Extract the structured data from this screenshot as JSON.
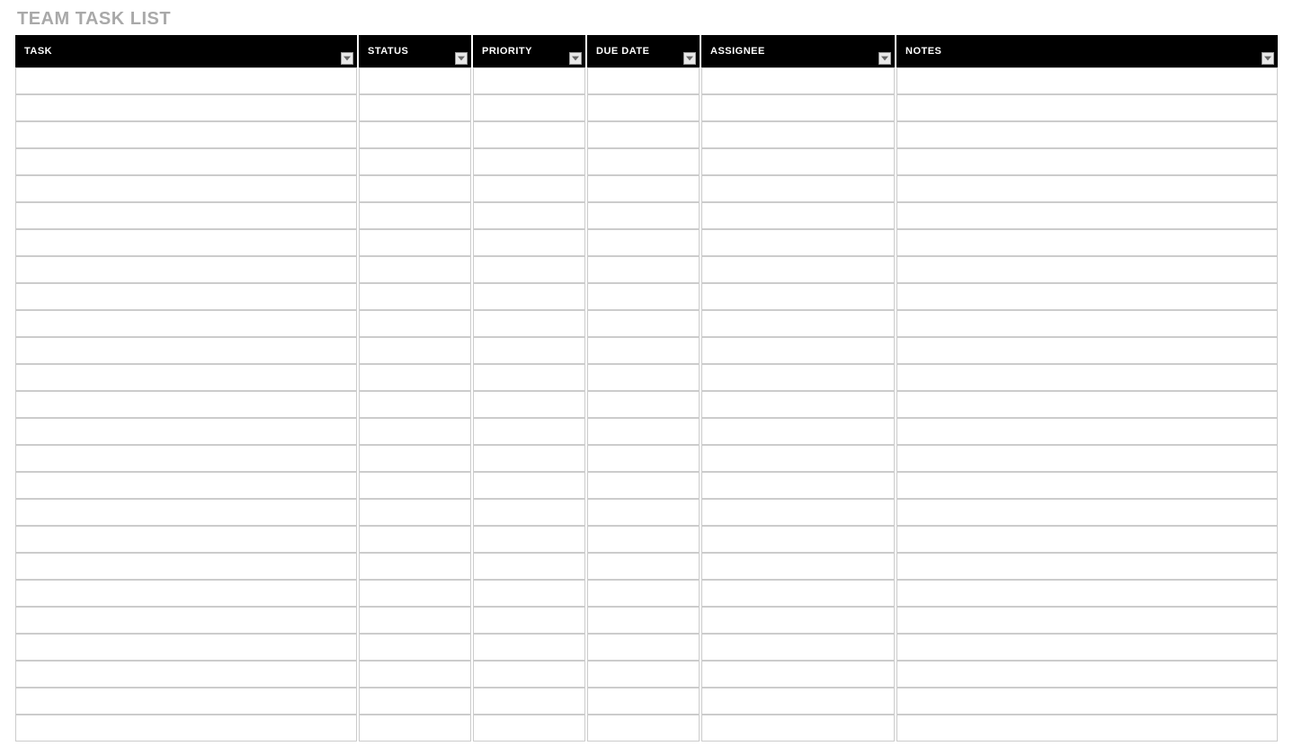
{
  "title": "TEAM TASK LIST",
  "columns": [
    {
      "label": "TASK",
      "key": "task",
      "filterable": true
    },
    {
      "label": "STATUS",
      "key": "status",
      "filterable": true
    },
    {
      "label": "PRIORITY",
      "key": "priority",
      "filterable": true
    },
    {
      "label": "DUE DATE",
      "key": "due_date",
      "filterable": true
    },
    {
      "label": "ASSIGNEE",
      "key": "assignee",
      "filterable": true
    },
    {
      "label": "NOTES",
      "key": "notes",
      "filterable": true
    }
  ],
  "rows": [
    {
      "task": "",
      "status": "",
      "priority": "",
      "due_date": "",
      "assignee": "",
      "notes": ""
    },
    {
      "task": "",
      "status": "",
      "priority": "",
      "due_date": "",
      "assignee": "",
      "notes": ""
    },
    {
      "task": "",
      "status": "",
      "priority": "",
      "due_date": "",
      "assignee": "",
      "notes": ""
    },
    {
      "task": "",
      "status": "",
      "priority": "",
      "due_date": "",
      "assignee": "",
      "notes": ""
    },
    {
      "task": "",
      "status": "",
      "priority": "",
      "due_date": "",
      "assignee": "",
      "notes": ""
    },
    {
      "task": "",
      "status": "",
      "priority": "",
      "due_date": "",
      "assignee": "",
      "notes": ""
    },
    {
      "task": "",
      "status": "",
      "priority": "",
      "due_date": "",
      "assignee": "",
      "notes": ""
    },
    {
      "task": "",
      "status": "",
      "priority": "",
      "due_date": "",
      "assignee": "",
      "notes": ""
    },
    {
      "task": "",
      "status": "",
      "priority": "",
      "due_date": "",
      "assignee": "",
      "notes": ""
    },
    {
      "task": "",
      "status": "",
      "priority": "",
      "due_date": "",
      "assignee": "",
      "notes": ""
    },
    {
      "task": "",
      "status": "",
      "priority": "",
      "due_date": "",
      "assignee": "",
      "notes": ""
    },
    {
      "task": "",
      "status": "",
      "priority": "",
      "due_date": "",
      "assignee": "",
      "notes": ""
    },
    {
      "task": "",
      "status": "",
      "priority": "",
      "due_date": "",
      "assignee": "",
      "notes": ""
    },
    {
      "task": "",
      "status": "",
      "priority": "",
      "due_date": "",
      "assignee": "",
      "notes": ""
    },
    {
      "task": "",
      "status": "",
      "priority": "",
      "due_date": "",
      "assignee": "",
      "notes": ""
    },
    {
      "task": "",
      "status": "",
      "priority": "",
      "due_date": "",
      "assignee": "",
      "notes": ""
    },
    {
      "task": "",
      "status": "",
      "priority": "",
      "due_date": "",
      "assignee": "",
      "notes": ""
    },
    {
      "task": "",
      "status": "",
      "priority": "",
      "due_date": "",
      "assignee": "",
      "notes": ""
    },
    {
      "task": "",
      "status": "",
      "priority": "",
      "due_date": "",
      "assignee": "",
      "notes": ""
    },
    {
      "task": "",
      "status": "",
      "priority": "",
      "due_date": "",
      "assignee": "",
      "notes": ""
    },
    {
      "task": "",
      "status": "",
      "priority": "",
      "due_date": "",
      "assignee": "",
      "notes": ""
    },
    {
      "task": "",
      "status": "",
      "priority": "",
      "due_date": "",
      "assignee": "",
      "notes": ""
    },
    {
      "task": "",
      "status": "",
      "priority": "",
      "due_date": "",
      "assignee": "",
      "notes": ""
    },
    {
      "task": "",
      "status": "",
      "priority": "",
      "due_date": "",
      "assignee": "",
      "notes": ""
    },
    {
      "task": "",
      "status": "",
      "priority": "",
      "due_date": "",
      "assignee": "",
      "notes": ""
    }
  ]
}
